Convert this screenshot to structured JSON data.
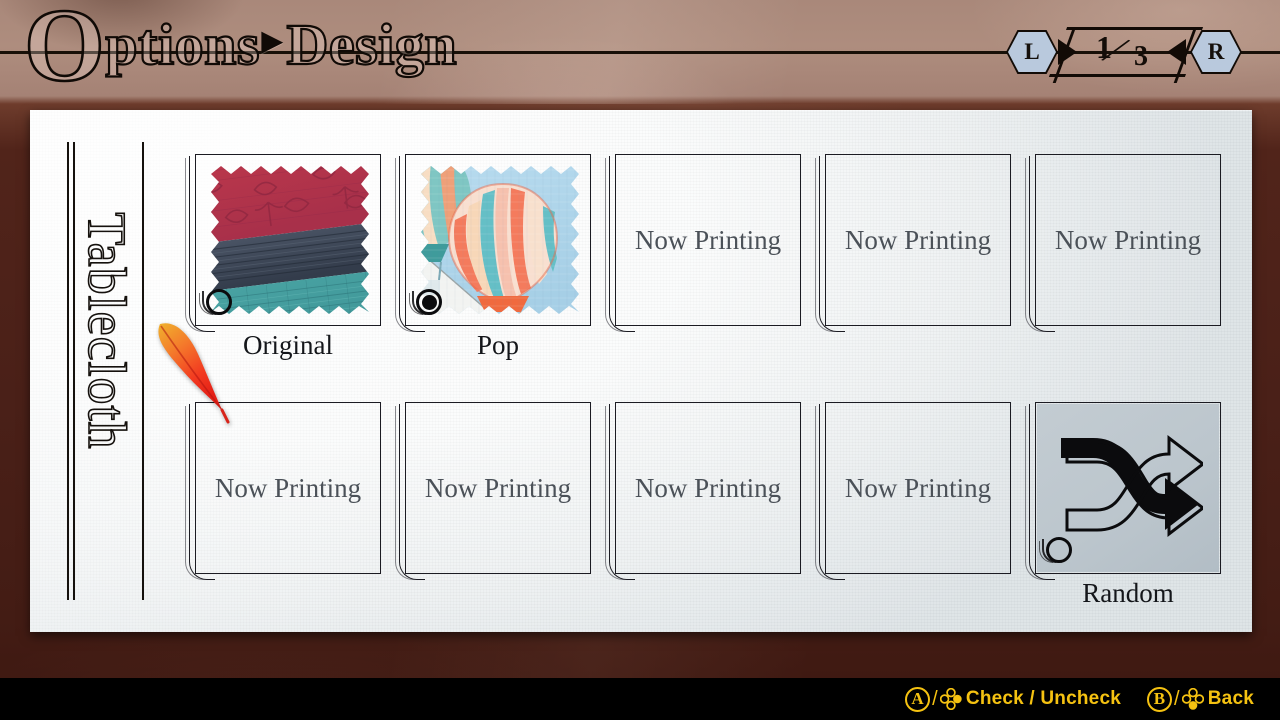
{
  "header": {
    "title_initial": "O",
    "title_rest": "ptions",
    "separator": "▸",
    "subtitle": "Design"
  },
  "pager": {
    "left_button": "L",
    "right_button": "R",
    "current_page": "1",
    "slash": "⁄",
    "total_pages": "3",
    "prev_arrow_icon": "triangle-left-icon",
    "next_arrow_icon": "triangle-right-icon",
    "button_color": "#b9c9dd"
  },
  "sidebar": {
    "category_label": "Tablecloth"
  },
  "grid": {
    "empty_label": "Now Printing",
    "items": [
      {
        "id": "original",
        "caption": "Original",
        "kind": "swatch-fabric",
        "checked": false,
        "has_caption": true
      },
      {
        "id": "pop",
        "caption": "Pop",
        "kind": "swatch-balloon",
        "checked": true,
        "has_caption": true
      },
      {
        "id": "slot-3",
        "caption": "",
        "kind": "empty",
        "checked": null,
        "has_caption": false
      },
      {
        "id": "slot-4",
        "caption": "",
        "kind": "empty",
        "checked": null,
        "has_caption": false
      },
      {
        "id": "slot-5",
        "caption": "",
        "kind": "empty",
        "checked": null,
        "has_caption": false
      },
      {
        "id": "slot-6",
        "caption": "",
        "kind": "empty",
        "checked": null,
        "has_caption": false
      },
      {
        "id": "slot-7",
        "caption": "",
        "kind": "empty",
        "checked": null,
        "has_caption": false
      },
      {
        "id": "slot-8",
        "caption": "",
        "kind": "empty",
        "checked": null,
        "has_caption": false
      },
      {
        "id": "slot-9",
        "caption": "",
        "kind": "empty",
        "checked": null,
        "has_caption": false
      },
      {
        "id": "random",
        "caption": "Random",
        "kind": "random",
        "checked": false,
        "has_caption": true
      }
    ]
  },
  "cursor": {
    "icon": "quill-feather-cursor",
    "gradient_from": "#f2c13a",
    "gradient_to": "#f03022"
  },
  "footer": {
    "hints": [
      {
        "button": "A",
        "glyph": "face-buttons-cluster-icon",
        "label": "Check / Uncheck"
      },
      {
        "button": "B",
        "glyph": "face-buttons-cluster-icon",
        "label": "Back"
      }
    ],
    "accent_color": "#f5c211",
    "background_color": "#000000"
  },
  "theme": {
    "wood_light": "#a9887a",
    "wood_dark": "#4a2018",
    "paper_light": "#ffffff",
    "paper_shadow": "#cfd7dc",
    "ink": "#15110d"
  }
}
